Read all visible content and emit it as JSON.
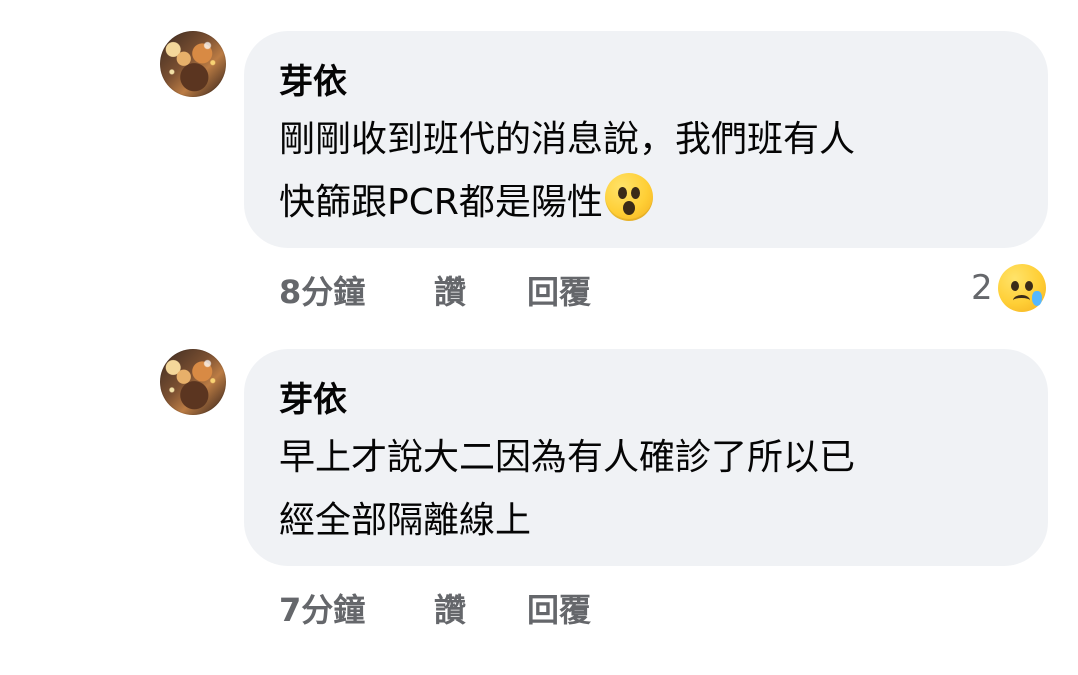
{
  "comments": [
    {
      "author": "芽依",
      "text_lines": [
        "剛剛收到班代的消息說，我們班有人",
        "快篩跟PCR都是陽性"
      ],
      "inline_emoji": "surprised-face-emoji",
      "time": "8分鐘",
      "like": "讚",
      "reply": "回覆",
      "reaction_count": "2",
      "reaction_icon": "sad-face-icon"
    },
    {
      "author": "芽依",
      "text_lines": [
        "早上才說大二因為有人確診了所以已",
        "經全部隔離線上"
      ],
      "time": "7分鐘",
      "like": "讚",
      "reply": "回覆"
    }
  ],
  "colors": {
    "bubble": "#f0f2f5",
    "text": "#050505",
    "meta": "#65676b"
  }
}
